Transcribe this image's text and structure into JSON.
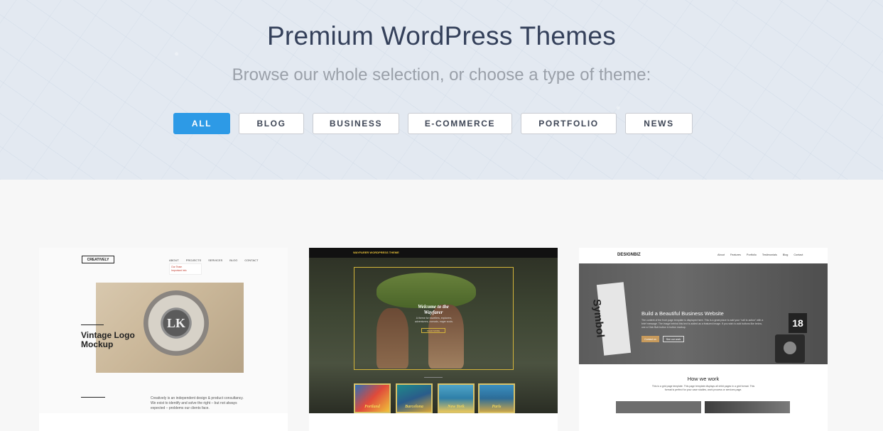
{
  "hero": {
    "title": "Premium WordPress Themes",
    "subtitle": "Browse our whole selection, or choose a type of theme:"
  },
  "filters": [
    {
      "label": "ALL",
      "active": true
    },
    {
      "label": "BLOG",
      "active": false
    },
    {
      "label": "BUSINESS",
      "active": false
    },
    {
      "label": "E-COMMERCE",
      "active": false
    },
    {
      "label": "PORTFOLIO",
      "active": false
    },
    {
      "label": "NEWS",
      "active": false
    }
  ],
  "colors": {
    "accent": "#2d9ae6",
    "title": "#34405a",
    "subtitle": "#9aa0a9",
    "hero_bg": "#e3e9f1",
    "page_bg": "#f7f7f7"
  },
  "themes": [
    {
      "logo": "CREATIVELY",
      "nav": [
        "ABOUT",
        "PROJECTS",
        "SERVICES",
        "BLOG",
        "CONTACT"
      ],
      "dropdown": [
        "Our Team",
        "Important Info"
      ],
      "badge": "LK",
      "headline": "Vintage Logo Mockup",
      "about": "Creatively is an independent design & product consultancy. We exist to identify and solve the right – but not always expected – problems our clients face."
    },
    {
      "bar": "WAYFARER WORDPRESS THEME",
      "welcome": "Welcome to the Wayfarer",
      "blurb": "A theme for travellers, explorers, adventurers, nomads, eager souls.",
      "more": "READ MORE",
      "posters": [
        "Portland",
        "Barcelona",
        "New York",
        "Paris"
      ]
    },
    {
      "brand": "DESIGNBIZ",
      "nav": [
        "About",
        "Features",
        "Portfolio",
        "Testimonials",
        "Blog",
        "Contact"
      ],
      "book": "Symbol",
      "calendar": "18",
      "headline": "Build a Beautiful Business Website",
      "body": "The content of the front page template is displayed here. This is a great place to add your \"call to action\" with a brief message. The image behind this text is added as a featured image. If you wish to add buttons like below, use a Click Butt button & button markup.",
      "primary": "Contact us",
      "secondary": "See our work",
      "section": "How we work",
      "section_body": "This is a grid page template. This page template displays all child pages in a grid format. This format is perfect for your case studies, work process or services page."
    }
  ]
}
